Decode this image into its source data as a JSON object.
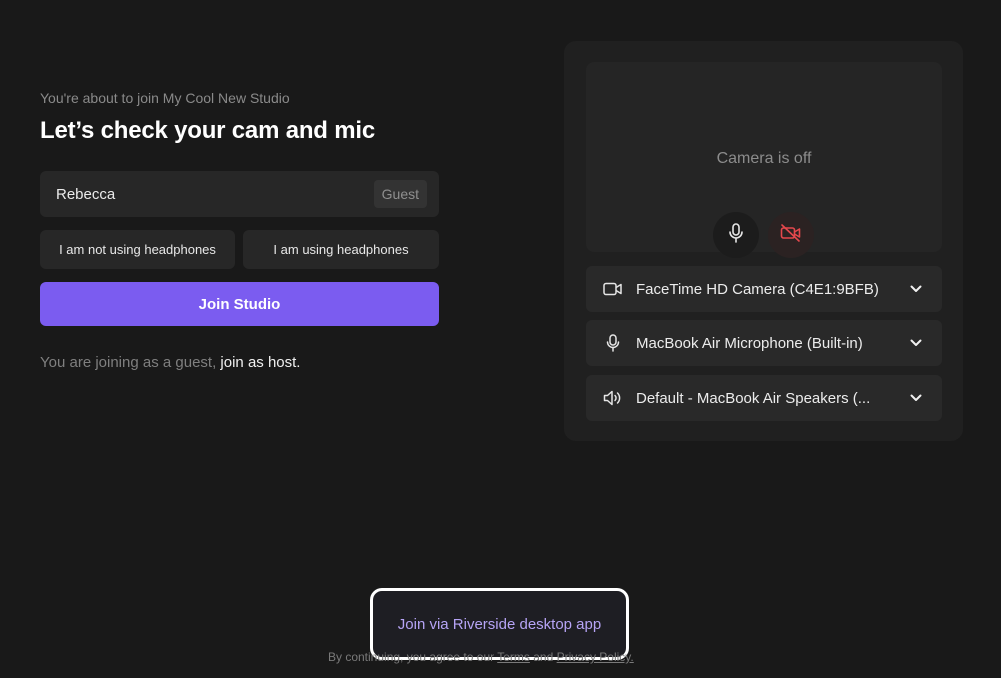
{
  "header": {
    "pre_title": "You're about to join My Cool New Studio",
    "title": "Let’s check your cam and mic"
  },
  "name_field": {
    "value": "Rebecca",
    "tag": "Guest"
  },
  "headphones": {
    "not_using": "I am not using headphones",
    "using": "I am using headphones"
  },
  "join_button": "Join Studio",
  "guest_notice": {
    "text": "You are joining as a guest,",
    "link": "join as host."
  },
  "preview": {
    "status": "Camera is off",
    "mic_icon": "microphone-icon",
    "cam_icon": "camera-off-icon"
  },
  "devices": {
    "camera": {
      "label": "FaceTime HD Camera (C4E1:9BFB)",
      "icon": "video-camera-icon"
    },
    "microphone": {
      "label": "MacBook Air Microphone (Built-in)",
      "icon": "microphone-icon"
    },
    "speaker": {
      "label": "Default - MacBook Air Speakers (...",
      "icon": "speaker-icon"
    }
  },
  "desktop_app_button": "Join via Riverside desktop app",
  "terms": {
    "prefix": "By continuing, you agree to our",
    "terms_link": "Terms",
    "and": "and",
    "privacy_link": "Privacy Policy."
  },
  "colors": {
    "accent": "#7b5cf0",
    "background": "#191919",
    "danger": "#e5484d"
  }
}
